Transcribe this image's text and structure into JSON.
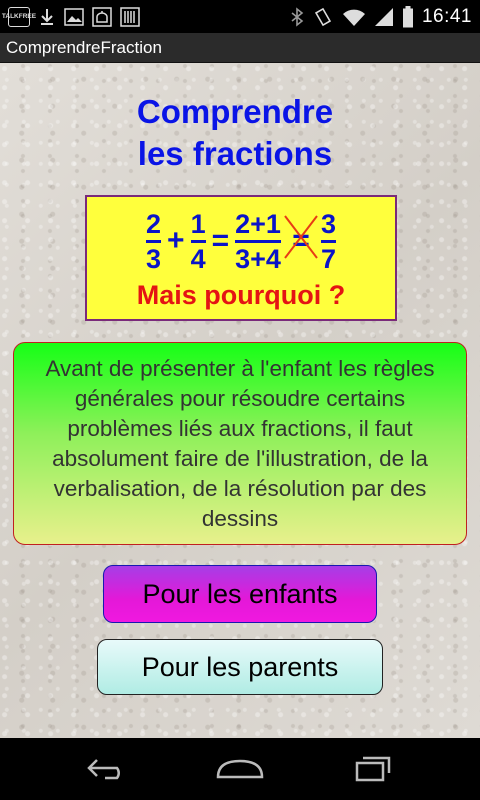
{
  "status_bar": {
    "talk_free_line1": "TALK",
    "talk_free_line2": "FREE",
    "time": "16:41"
  },
  "app_bar": {
    "title": "ComprendreFraction"
  },
  "main": {
    "title_line1": "Comprendre",
    "title_line2": "les fractions",
    "equation": {
      "f1_num": "2",
      "f1_den": "3",
      "plus": "+",
      "f2_num": "1",
      "f2_den": "4",
      "equals": "=",
      "f3_num": "2+1",
      "f3_den": "3+4",
      "wrong_equals": "=",
      "f4_num": "3",
      "f4_den": "7"
    },
    "question": "Mais pourquoi ?",
    "info_text": "Avant de présenter à l'enfant les règles générales pour résoudre certains problèmes liés aux fractions, il faut absolument faire de l'illustration, de la verbalisation, de la résolution par des dessins",
    "button_children": "Pour les enfants",
    "button_parents": "Pour les parents"
  },
  "colors": {
    "title": "#0a14e6",
    "equation_bg": "#ffff3c",
    "question": "#e41414"
  }
}
